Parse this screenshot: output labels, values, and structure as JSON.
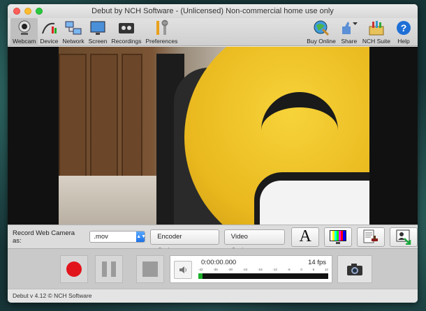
{
  "window": {
    "title": "Debut by NCH Software - (Unlicensed) Non-commercial home use only"
  },
  "toolbar": {
    "left": [
      {
        "label": "Webcam",
        "icon": "webcam-icon",
        "active": true
      },
      {
        "label": "Device",
        "icon": "device-icon"
      },
      {
        "label": "Network",
        "icon": "network-icon"
      },
      {
        "label": "Screen",
        "icon": "screen-icon"
      },
      {
        "label": "Recordings",
        "icon": "recordings-icon"
      },
      {
        "label": "Preferences",
        "icon": "preferences-icon"
      }
    ],
    "right": [
      {
        "label": "Buy Online",
        "icon": "buy-online-icon"
      },
      {
        "label": "Share",
        "icon": "share-icon"
      },
      {
        "label": "NCH Suite",
        "icon": "nch-suite-icon"
      },
      {
        "label": "Help",
        "icon": "help-icon"
      }
    ]
  },
  "options": {
    "record_label": "Record Web Camera as:",
    "format_value": ".mov",
    "encoder_label": "Encoder Options...",
    "video_label": "Video Options...",
    "text_glyph": "A"
  },
  "transport": {
    "time": "0:00:00.000",
    "fps": "14 fps",
    "db_scale": [
      "-42",
      "-36",
      "-30",
      "-24",
      "-18",
      "-12",
      "-6",
      "0",
      "6",
      "12"
    ],
    "level_fraction": 0.03
  },
  "status": {
    "text": "Debut v 4.12 © NCH Software"
  },
  "colors": {
    "record": "#e2141b",
    "meter": "#1cae2a",
    "accent": "#1c72e8"
  }
}
